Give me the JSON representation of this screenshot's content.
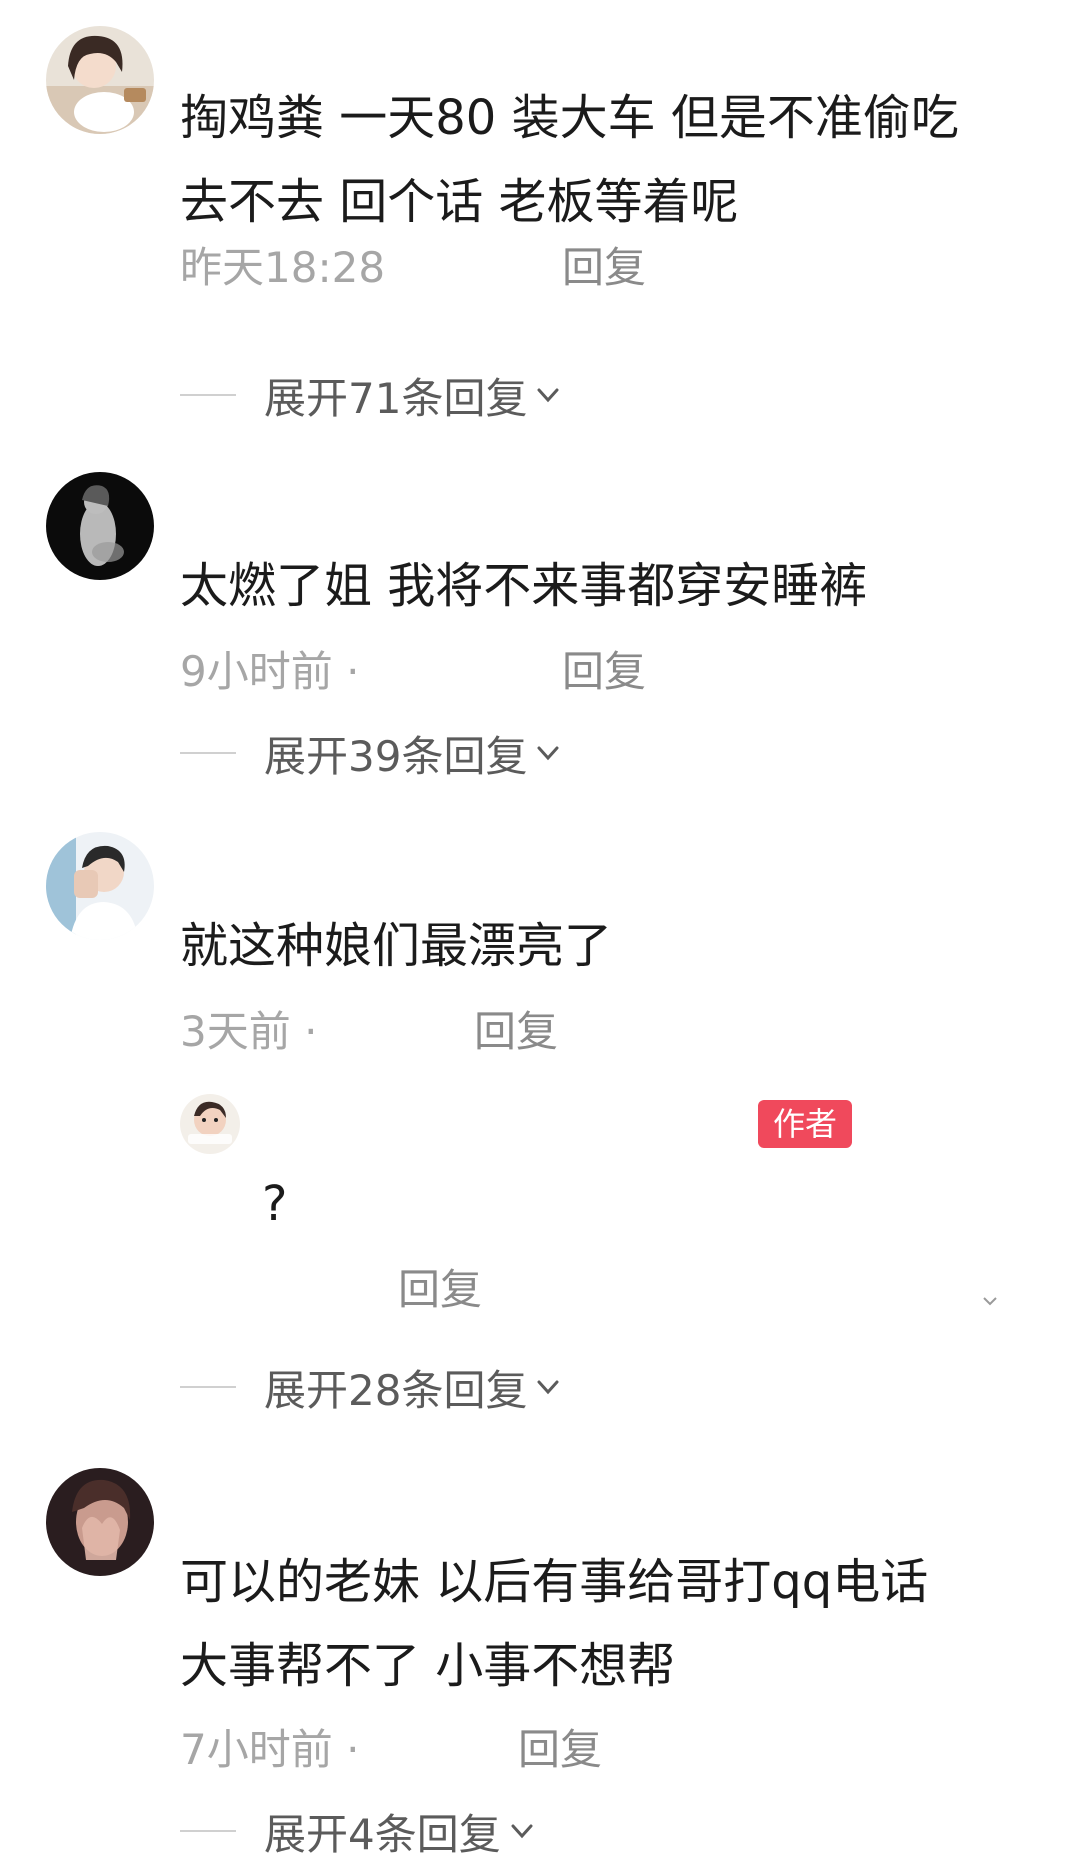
{
  "comments": [
    {
      "text_line1": "掏鸡粪 一天80 装大车  但是不准偷吃",
      "text_line2": "去不去 回个话 老板等着呢",
      "time": "昨天18:28",
      "reply_label": "回复",
      "expand_label": "展开71条回复"
    },
    {
      "text_line1": "太燃了姐 我将不来事都穿安睡裤",
      "time": "9小时前 ·",
      "reply_label": "回复",
      "expand_label": "展开39条回复"
    },
    {
      "text_line1": "就这种娘们最漂亮了",
      "time": "3天前 ·",
      "reply_label": "回复",
      "sub_reply": {
        "badge": "作者",
        "text": "?",
        "reply_label": "回复"
      },
      "expand_label": "展开28条回复"
    },
    {
      "text_line1": "可以的老妹 以后有事给哥打qq电话",
      "text_line2": "大事帮不了 小事不想帮",
      "time": "7小时前 ·",
      "reply_label": "回复",
      "expand_label": "展开4条回复"
    }
  ],
  "colors": {
    "author_badge": "#f0495c",
    "time_text": "#a6a6a6",
    "reply_text": "#8a8a8a"
  }
}
